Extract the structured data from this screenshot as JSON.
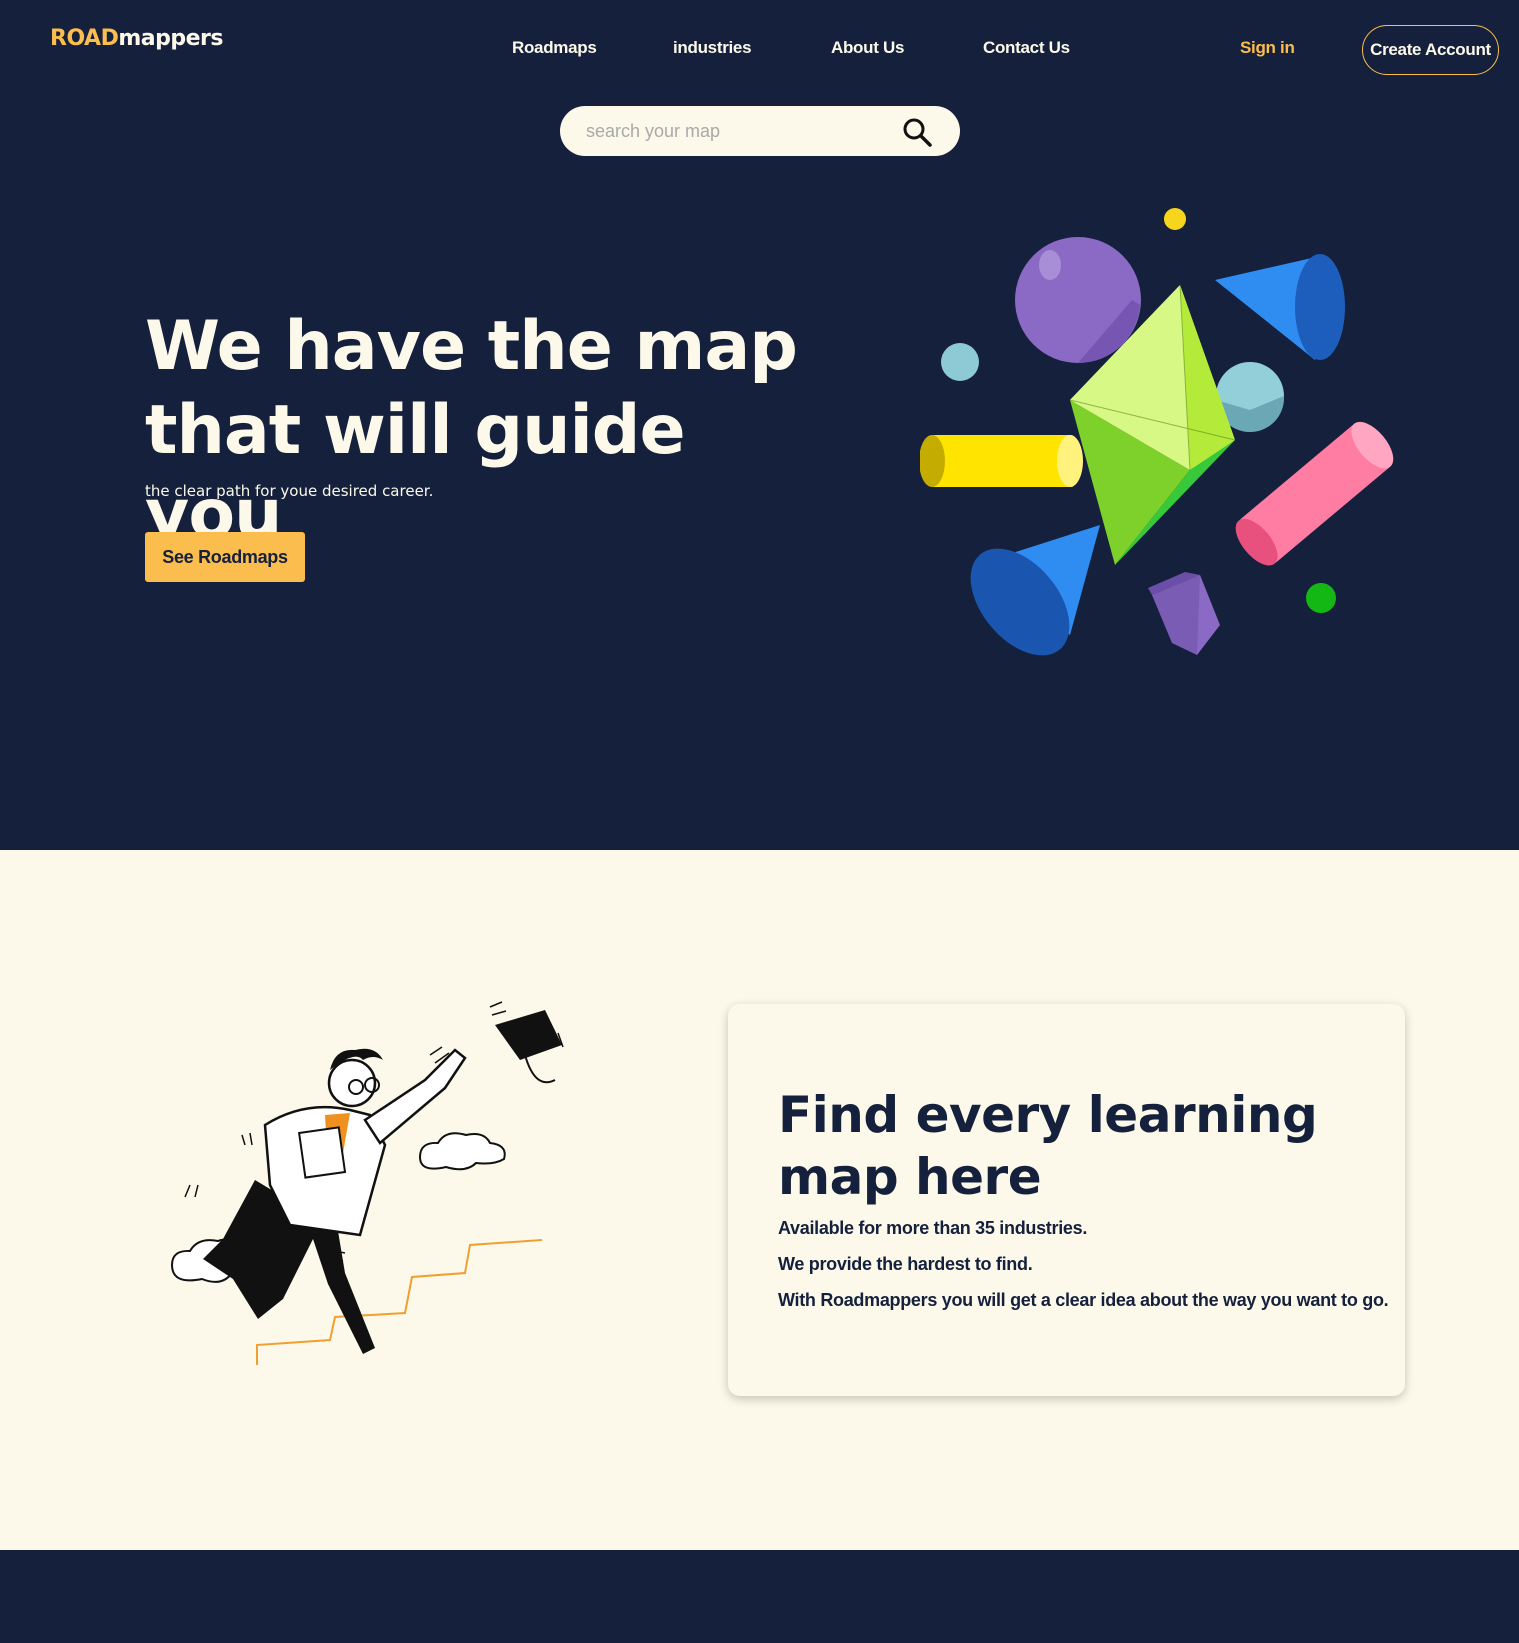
{
  "brand": {
    "logo_part1": "ROAD",
    "logo_part2": "mappers"
  },
  "nav": {
    "items": [
      "Roadmaps",
      "industries",
      "About Us",
      "Contact Us"
    ]
  },
  "auth": {
    "signin": "Sign in",
    "create": "Create Account"
  },
  "search": {
    "placeholder": "search your map"
  },
  "hero": {
    "headline_line1": "We have the map",
    "headline_line2": "that will guide you",
    "subtitle": "the clear path for youe desired career.",
    "cta": "See Roadmaps"
  },
  "feature": {
    "title_line1": "Find every learning",
    "title_line2": "map here",
    "lines": [
      "Available for more than 35 industries.",
      "We provide the hardest to find.",
      "With Roadmappers you will get a clear idea about the way you want to go."
    ]
  },
  "colors": {
    "navy": "#15203d",
    "accent": "#fbbd4d",
    "cream": "#fcf9ea"
  },
  "icons": {
    "search": "search-icon"
  }
}
